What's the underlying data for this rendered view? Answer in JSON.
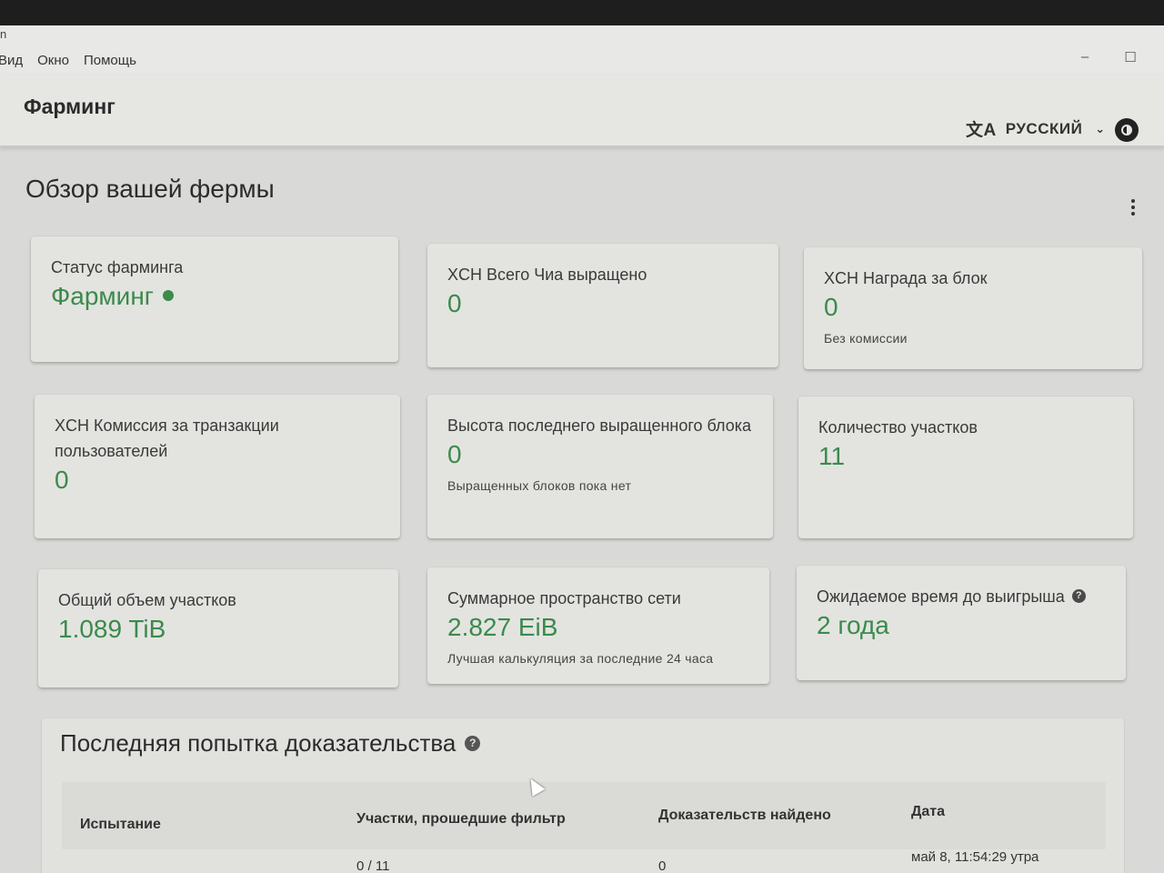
{
  "window": {
    "title_fragment": "n"
  },
  "menubar": {
    "items": [
      "Вид",
      "Окно",
      "Помощь"
    ]
  },
  "window_controls": {
    "minimize": "–",
    "maximize": "☐"
  },
  "header": {
    "title": "Фарминг",
    "language": "РУССКИЙ",
    "translate_icon": "文A",
    "chevron": "⌄"
  },
  "page": {
    "title": "Обзор вашей фермы"
  },
  "cards": [
    {
      "title": "Статус фарминга",
      "value": "Фарминг",
      "status_color": "#3c8a4c"
    },
    {
      "title": "XCH Всего Чиа выращено",
      "value": "0"
    },
    {
      "title": "XCH Награда за блок",
      "value": "0",
      "sub": "Без комиссии"
    },
    {
      "title": "XCH Комиссия за транзакции пользователей",
      "value": "0"
    },
    {
      "title": "Высота последнего выращенного блока",
      "value": "0",
      "sub": "Выращенных блоков пока нет"
    },
    {
      "title": "Количество участков",
      "value": "11"
    },
    {
      "title": "Общий объем участков",
      "value": "1.089 TiB"
    },
    {
      "title": "Суммарное пространство сети",
      "value": "2.827 EiB",
      "sub": "Лучшая калькуляция за последние 24 часа"
    },
    {
      "title": "Ожидаемое время до выигрыша",
      "value": "2 года",
      "help": "?"
    }
  ],
  "proofs": {
    "title": "Последняя попытка доказательства",
    "help": "?",
    "columns": [
      "Испытание",
      "Участки, прошедшие фильтр",
      "Доказательств найдено",
      "Дата"
    ],
    "rows": [
      {
        "challenge": "",
        "passed": "0 / 11",
        "found": "0",
        "date": "май 8, 11:54:29 утра"
      }
    ]
  },
  "colors": {
    "accent": "#3c8a4c",
    "card_bg": "#e3e4e0"
  }
}
